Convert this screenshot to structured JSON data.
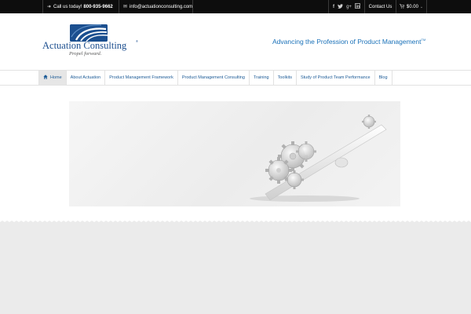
{
  "topbar": {
    "phone_prefix": "Call us today!",
    "phone_number": "800-935-9662",
    "email": "info@actuationconsulting.com",
    "contact_label": "Contact Us",
    "cart_label": "$0.00",
    "icons": [
      "arrow-right-icon",
      "envelope-icon",
      "facebook-icon",
      "twitter-icon",
      "google-plus-icon",
      "linkedin-icon",
      "cart-icon",
      "chevron-down-icon"
    ]
  },
  "header": {
    "logo_name": "Actuation Consulting",
    "logo_reg": "®",
    "logo_tagline": "Propel forward.",
    "tagline": "Advancing the Profession of Product Management",
    "tagline_tm": "TM"
  },
  "nav": {
    "items": [
      {
        "label": "Home",
        "active": true
      },
      {
        "label": "About Actuation"
      },
      {
        "label": "Product Management Framework"
      },
      {
        "label": "Product Management Consulting"
      },
      {
        "label": "Training"
      },
      {
        "label": "Toolkits"
      },
      {
        "label": "Study of Product Team Performance"
      },
      {
        "label": "Blog"
      }
    ]
  },
  "colors": {
    "topbar_bg": "#0d0d0d",
    "brand_blue": "#1d4f8f",
    "link_blue": "#1b72b9",
    "footer_bg": "#ebebeb"
  }
}
